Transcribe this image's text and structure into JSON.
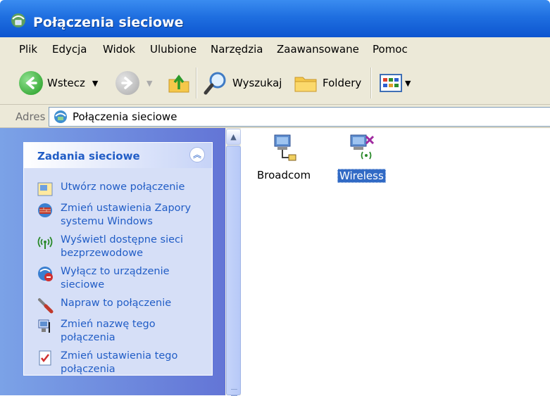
{
  "window": {
    "title": "Połączenia sieciowe",
    "title_icon": "network-connections-icon"
  },
  "menu": [
    "Plik",
    "Edycja",
    "Widok",
    "Ulubione",
    "Narzędzia",
    "Zaawansowane",
    "Pomoc"
  ],
  "toolbar": {
    "back_label": "Wstecz",
    "search_label": "Wyszukaj",
    "folders_label": "Foldery",
    "icons": [
      "back-arrow-icon",
      "forward-arrow-icon",
      "up-folder-icon",
      "search-icon",
      "folders-icon",
      "views-icon"
    ]
  },
  "address": {
    "label": "Adres",
    "value": "Połączenia sieciowe"
  },
  "tasks_panel": {
    "title": "Zadania sieciowe",
    "items": [
      {
        "label": "Utwórz nowe połączenie",
        "icon": "new-connection-icon"
      },
      {
        "label": "Zmień ustawienia Zapory systemu Windows",
        "icon": "firewall-icon"
      },
      {
        "label": "Wyświetl dostępne sieci bezprzewodowe",
        "icon": "wireless-signal-icon"
      },
      {
        "label": "Wyłącz to urządzenie sieciowe",
        "icon": "disable-device-icon"
      },
      {
        "label": "Napraw to połączenie",
        "icon": "repair-tool-icon"
      },
      {
        "label": "Zmień nazwę tego połączenia",
        "icon": "rename-icon"
      },
      {
        "label": "Zmień ustawienia tego połączenia",
        "icon": "properties-icon"
      }
    ]
  },
  "connections": [
    {
      "label": "Broadcom",
      "icon": "lan-connection-icon",
      "selected": false
    },
    {
      "label": "Wireless",
      "icon": "wireless-connection-disabled-icon",
      "selected": true
    }
  ],
  "colors": {
    "title_blue": "#0d55d0",
    "task_link": "#215dc6",
    "selection": "#316ac5",
    "chrome": "#ece9d8"
  }
}
